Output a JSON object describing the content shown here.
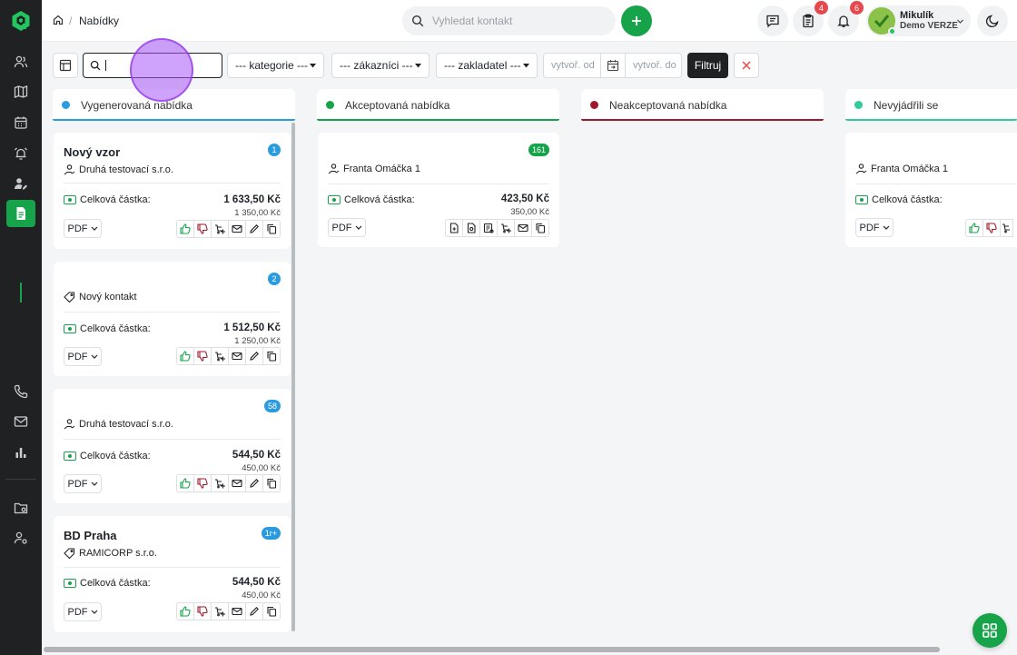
{
  "header": {
    "breadcrumb_page": "Nabídky",
    "breadcrumb_sep": "/",
    "search_placeholder": "Vyhledat kontakt",
    "tasks_badge": "4",
    "notifications_badge": "6",
    "user_name": "Mikulík",
    "user_org": "Demo VERZE"
  },
  "filters": {
    "search_value": "",
    "category": "--- kategorie ---",
    "customers": "--- zákazníci ---",
    "founder": "--- zakladatel ---",
    "created_from": "vytvoř. od",
    "created_to": "vytvoř. do",
    "filter_button": "Filtruj"
  },
  "columns": [
    {
      "title": "Vygenerovaná nabídka",
      "color": "#2b9be0"
    },
    {
      "title": "Akceptovaná nabídka",
      "color": "#16a34a"
    },
    {
      "title": "Neakceptovaná nabídka",
      "color": "#a3172b"
    },
    {
      "title": "Nevyjádřili se",
      "color": "#2ecc9a"
    }
  ],
  "common": {
    "total_label": "Celková částka:",
    "pdf_label": "PDF"
  },
  "cards": [
    {
      "title": "Nový vzor",
      "badge": "1",
      "contact": "Druhá testovací s.r.o.",
      "contact_icon": "user-hand-icon",
      "amount": "1 633,50 Kč",
      "amount_sub": "1 350,00 Kč"
    },
    {
      "title": "",
      "badge": "2",
      "contact": "Nový kontakt",
      "contact_icon": "tag-icon",
      "amount": "1 512,50 Kč",
      "amount_sub": "1 250,00 Kč"
    },
    {
      "title": "",
      "badge": "58",
      "contact": "Druhá testovací s.r.o.",
      "contact_icon": "user-hand-icon",
      "amount": "544,50 Kč",
      "amount_sub": "450,00 Kč"
    },
    {
      "title": "BD Praha",
      "badge": "1r+",
      "contact": "RAMICORP s.r.o.",
      "contact_icon": "tag-icon",
      "amount": "544,50 Kč",
      "amount_sub": "450,00 Kč"
    },
    {
      "title": "",
      "badge": "161",
      "contact": "Franta Omáčka 1",
      "contact_icon": "user-hand-icon",
      "amount": "423,50 Kč",
      "amount_sub": "350,00 Kč"
    },
    {
      "title": "",
      "badge": "",
      "contact": "Franta Omáčka 1",
      "contact_icon": "user-hand-icon",
      "amount": "",
      "amount_sub": ""
    }
  ],
  "colors": {
    "accent": "#16a34a",
    "sidebar": "#1f2123",
    "badge_blue": "#2b9be0",
    "badge_green": "#16a34a",
    "badge_red": "#e5484d"
  }
}
